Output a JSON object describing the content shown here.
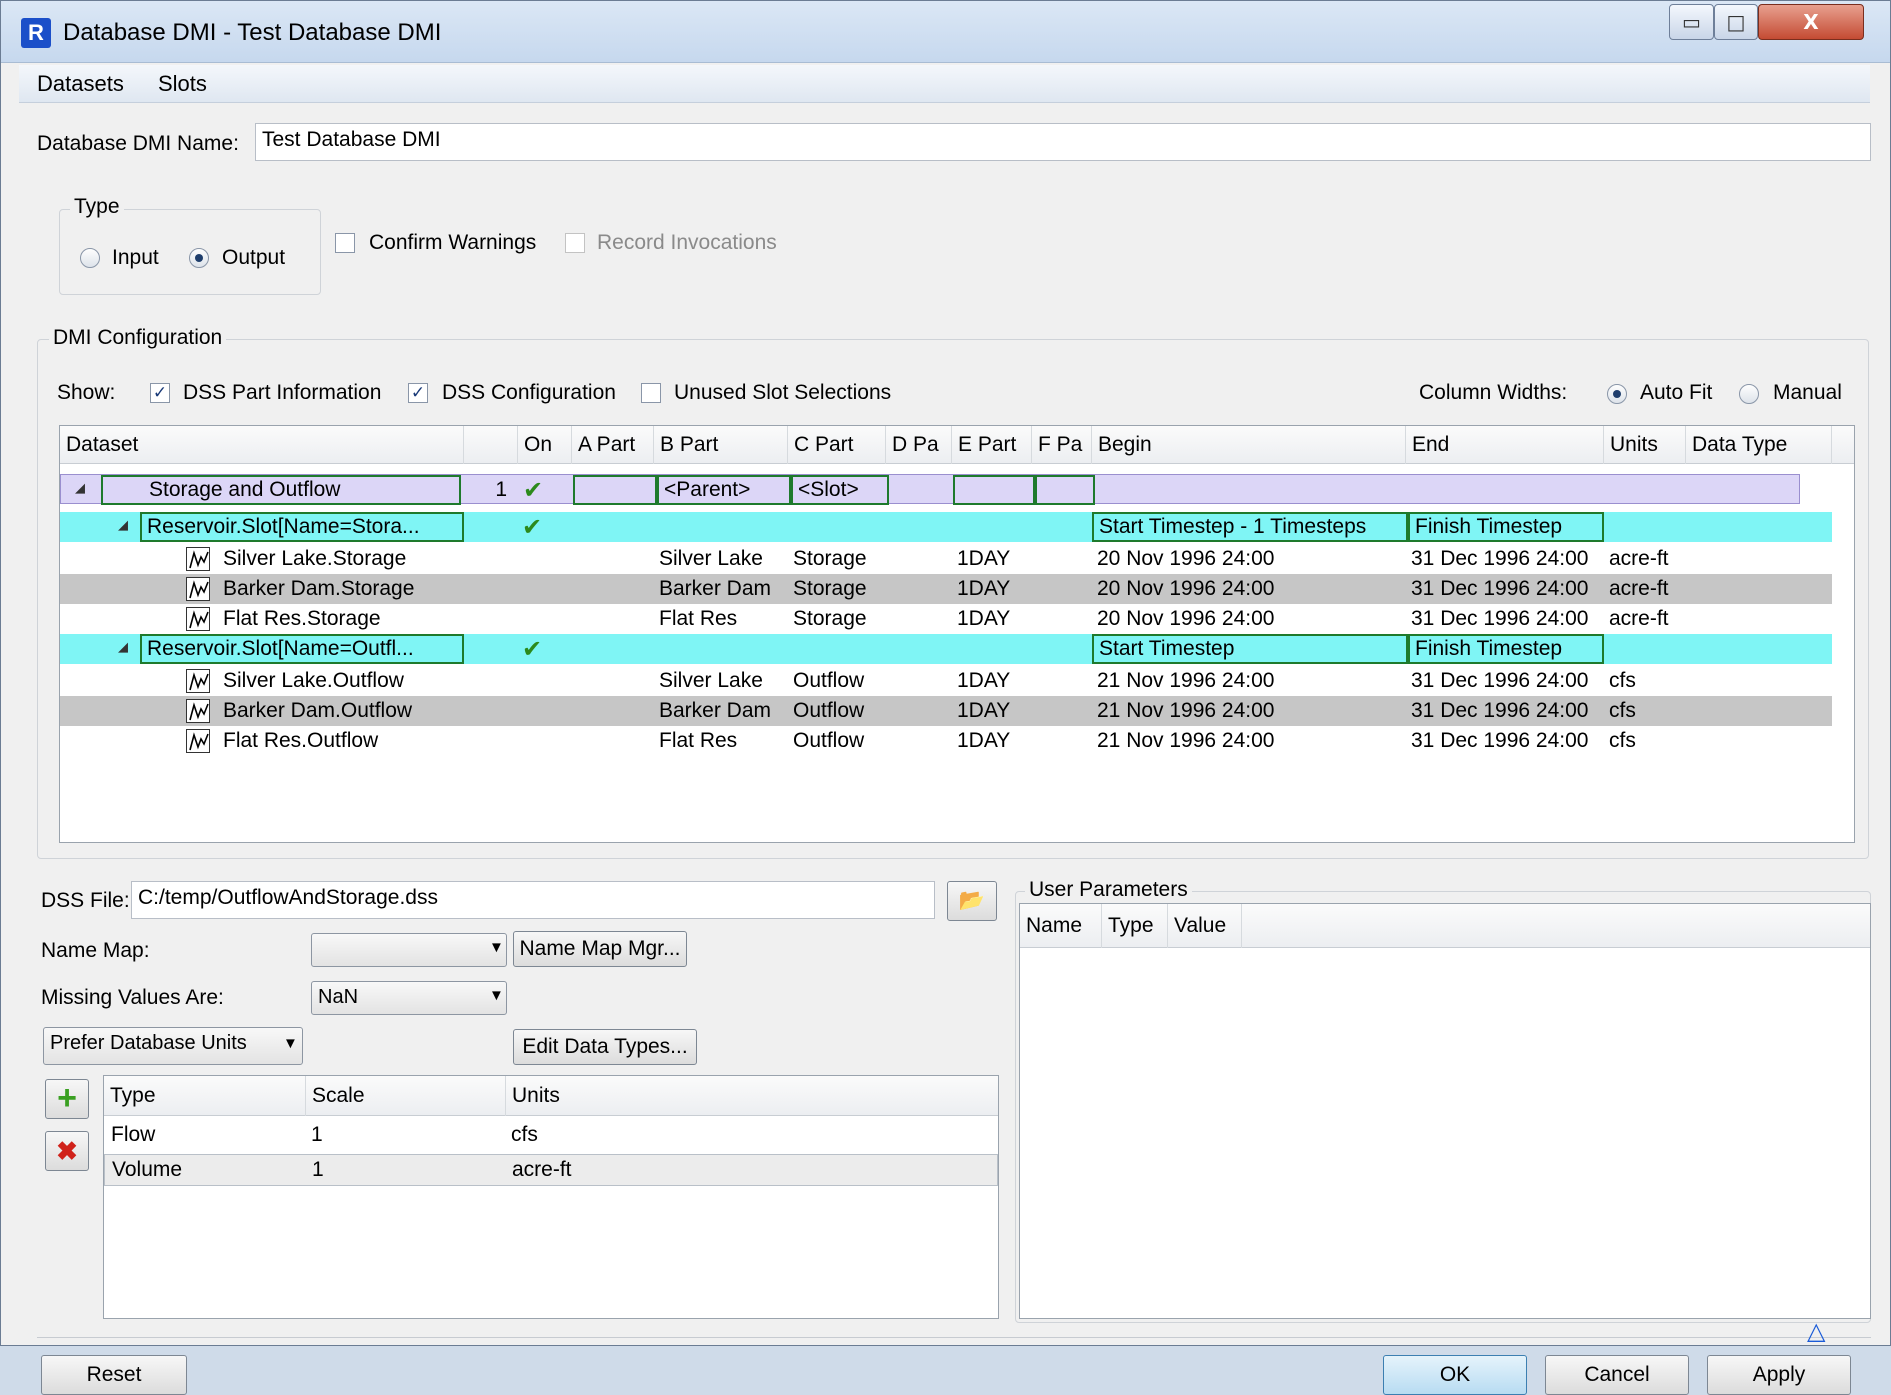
{
  "window": {
    "title": "Database DMI - Test Database DMI",
    "app_icon_glyph": "R",
    "controls": {
      "minimize": "▭",
      "maximize": "□",
      "close": "X"
    }
  },
  "menu": [
    "Datasets",
    "Slots"
  ],
  "dmi_name": {
    "label": "Database DMI Name:",
    "value": "Test Database DMI"
  },
  "type_group": {
    "title": "Type",
    "input_label": "Input",
    "output_label": "Output",
    "selected": "Output"
  },
  "options": {
    "confirm_warnings": {
      "label": "Confirm Warnings",
      "checked": false
    },
    "record_invocations": {
      "label": "Record Invocations",
      "checked": false,
      "disabled": true
    }
  },
  "dmi_config": {
    "title": "DMI Configuration",
    "show_label": "Show:",
    "dss_part_info": {
      "label": "DSS Part Information",
      "checked": true
    },
    "dss_config": {
      "label": "DSS Configuration",
      "checked": true
    },
    "unused_slot": {
      "label": "Unused Slot Selections",
      "checked": false
    },
    "column_widths_label": "Column Widths:",
    "auto_fit": "Auto Fit",
    "manual": "Manual",
    "column_widths_selected": "Auto Fit"
  },
  "table": {
    "columns": [
      "Dataset",
      "",
      "On",
      "A Part",
      "B Part",
      "C Part",
      "D Pa",
      "E Part",
      "F Pa",
      "Begin",
      "End",
      "Units",
      "Data Type"
    ],
    "rows": [
      {
        "level": 0,
        "kind": "dataset",
        "name": "Storage and Outflow",
        "num": "1",
        "on": true,
        "a": "",
        "b": "<Parent>",
        "c": "<Slot>",
        "e": "",
        "begin": "",
        "end": "",
        "units": ""
      },
      {
        "level": 1,
        "kind": "group",
        "name": "Reservoir.Slot[Name=Stora...",
        "on": true,
        "begin": "Start Timestep - 1 Timesteps",
        "end": "Finish Timestep"
      },
      {
        "level": 2,
        "kind": "slot",
        "name": "Silver Lake.Storage",
        "b": "Silver Lake",
        "c": "Storage",
        "e": "1DAY",
        "begin": "20 Nov 1996 24:00",
        "end": "31 Dec 1996 24:00",
        "units": "acre-ft",
        "selected": false
      },
      {
        "level": 2,
        "kind": "slot",
        "name": "Barker Dam.Storage",
        "b": "Barker Dam",
        "c": "Storage",
        "e": "1DAY",
        "begin": "20 Nov 1996 24:00",
        "end": "31 Dec 1996 24:00",
        "units": "acre-ft",
        "selected": true
      },
      {
        "level": 2,
        "kind": "slot",
        "name": "Flat Res.Storage",
        "b": "Flat Res",
        "c": "Storage",
        "e": "1DAY",
        "begin": "20 Nov 1996 24:00",
        "end": "31 Dec 1996 24:00",
        "units": "acre-ft",
        "selected": false
      },
      {
        "level": 1,
        "kind": "group",
        "name": "Reservoir.Slot[Name=Outfl...",
        "on": true,
        "begin": "Start Timestep",
        "end": "Finish Timestep"
      },
      {
        "level": 2,
        "kind": "slot",
        "name": "Silver Lake.Outflow",
        "b": "Silver Lake",
        "c": "Outflow",
        "e": "1DAY",
        "begin": "21 Nov 1996 24:00",
        "end": "31 Dec 1996 24:00",
        "units": "cfs",
        "selected": false
      },
      {
        "level": 2,
        "kind": "slot",
        "name": "Barker Dam.Outflow",
        "b": "Barker Dam",
        "c": "Outflow",
        "e": "1DAY",
        "begin": "21 Nov 1996 24:00",
        "end": "31 Dec 1996 24:00",
        "units": "cfs",
        "selected": true
      },
      {
        "level": 2,
        "kind": "slot",
        "name": "Flat Res.Outflow",
        "b": "Flat Res",
        "c": "Outflow",
        "e": "1DAY",
        "begin": "21 Nov 1996 24:00",
        "end": "31 Dec 1996 24:00",
        "units": "cfs",
        "selected": false
      }
    ]
  },
  "dss": {
    "file_label": "DSS File:",
    "file_value": "C:/temp/OutflowAndStorage.dss",
    "name_map_label": "Name Map:",
    "name_map_value": "",
    "name_map_mgr": "Name Map Mgr...",
    "missing_label": "Missing Values Are:",
    "missing_value": "NaN",
    "prefer_units": "Prefer Database Units",
    "edit_data_types": "Edit Data Types..."
  },
  "units_table": {
    "columns": [
      "Type",
      "Scale",
      "Units"
    ],
    "rows": [
      {
        "type": "Flow",
        "scale": "1",
        "units": "cfs"
      },
      {
        "type": "Volume",
        "scale": "1",
        "units": "acre-ft"
      }
    ]
  },
  "user_params": {
    "title": "User Parameters",
    "columns": [
      "Name",
      "Type",
      "Value"
    ]
  },
  "buttons": {
    "reset": "Reset",
    "ok": "OK",
    "cancel": "Cancel",
    "apply": "Apply"
  },
  "colors": {
    "dataset_row": "#dcd6f7",
    "group_row": "#7ff5f5",
    "selected_row": "#c6c6c6",
    "box_border": "#1e7a2c",
    "check_green": "#2c8a1c"
  }
}
